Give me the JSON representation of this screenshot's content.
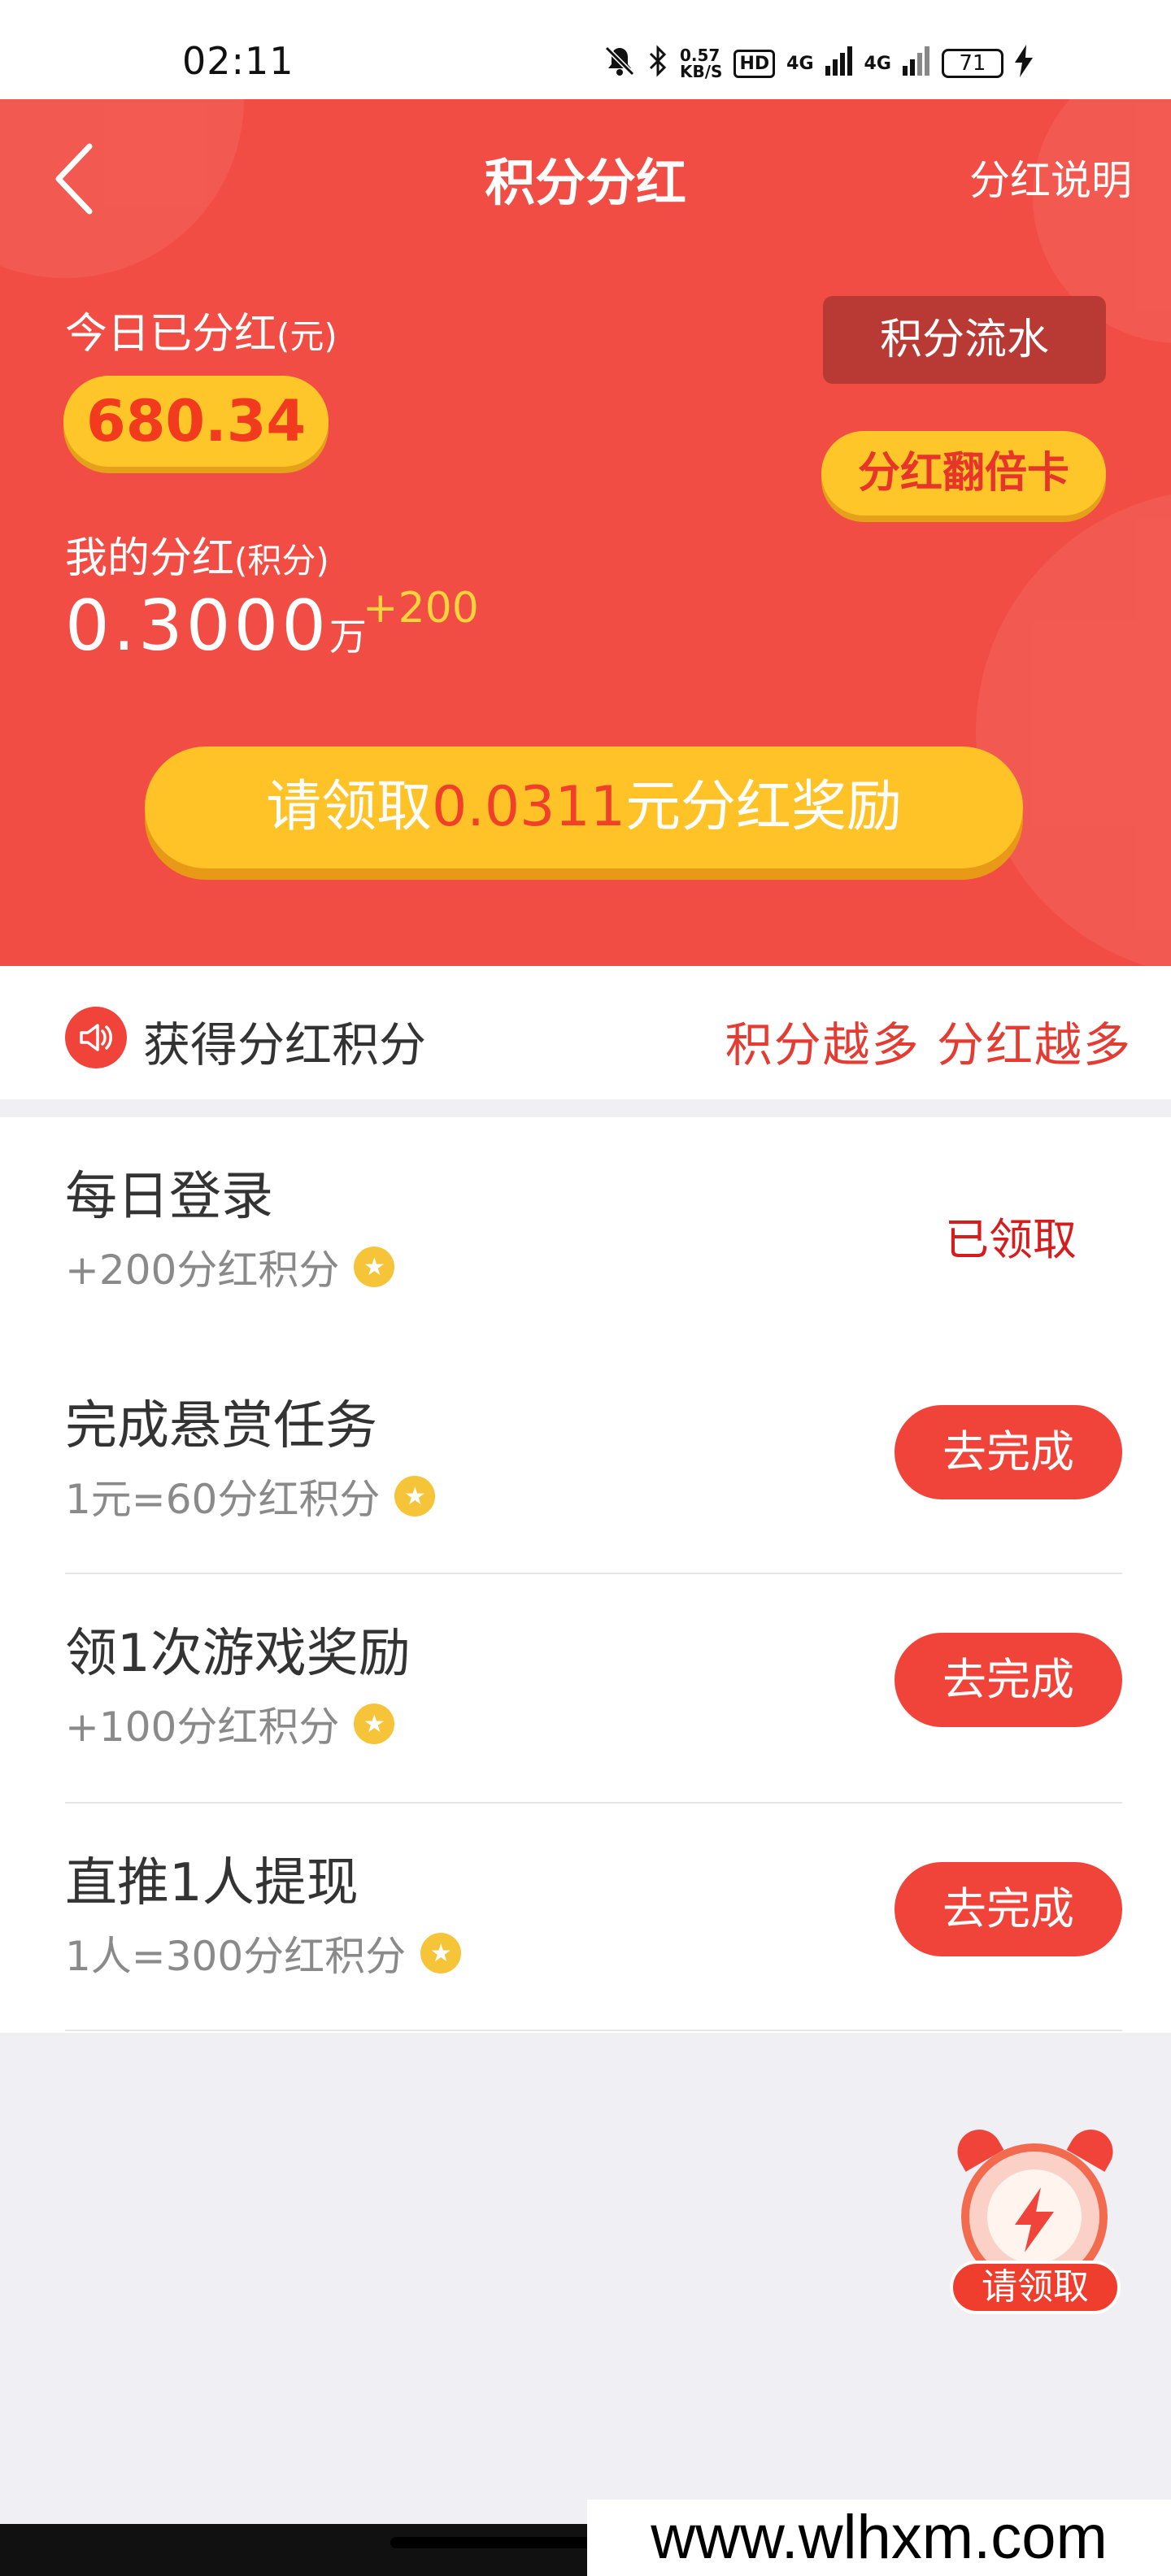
{
  "status_bar": {
    "time": "02:11",
    "net_speed_value": "0.57",
    "net_speed_unit": "KB/S",
    "hd_label": "HD",
    "net1": "4G",
    "net2": "4G",
    "battery": "71",
    "icons": [
      "bell-off-icon",
      "bluetooth-icon",
      "signal-icon",
      "charging-icon"
    ]
  },
  "header": {
    "title": "积分分红",
    "explain_link": "分红说明"
  },
  "summary": {
    "today_label": "今日已分红",
    "today_unit": "(元)",
    "today_value": "680.34",
    "flow_button": "积分流水",
    "double_card_button": "分红翻倍卡",
    "my_label": "我的分红",
    "my_unit": "(积分)",
    "my_value": "0.3000",
    "my_value_unit": "万",
    "my_increment": "+200"
  },
  "claim": {
    "prefix": "请领取",
    "amount": "0.0311",
    "suffix": "元分红奖励"
  },
  "info_bar": {
    "title": "获得分红积分",
    "slogan": "积分越多 分红越多"
  },
  "tasks": [
    {
      "title": "每日登录",
      "sub": "+200分红积分",
      "action": "已领取",
      "done": true
    },
    {
      "title": "完成悬赏任务",
      "sub": "1元=60分红积分",
      "action": "去完成",
      "done": false
    },
    {
      "title": "领1次游戏奖励",
      "sub": "+100分红积分",
      "action": "去完成",
      "done": false
    },
    {
      "title": "直推1人提现",
      "sub": "1人=300分红积分",
      "action": "去完成",
      "done": false
    }
  ],
  "float_button": {
    "label": "请领取"
  },
  "watermark": "www.wlhxm.com",
  "colors": {
    "primary_red": "#f24d44",
    "gold": "#ffc62a",
    "button_red": "#f0443a"
  }
}
